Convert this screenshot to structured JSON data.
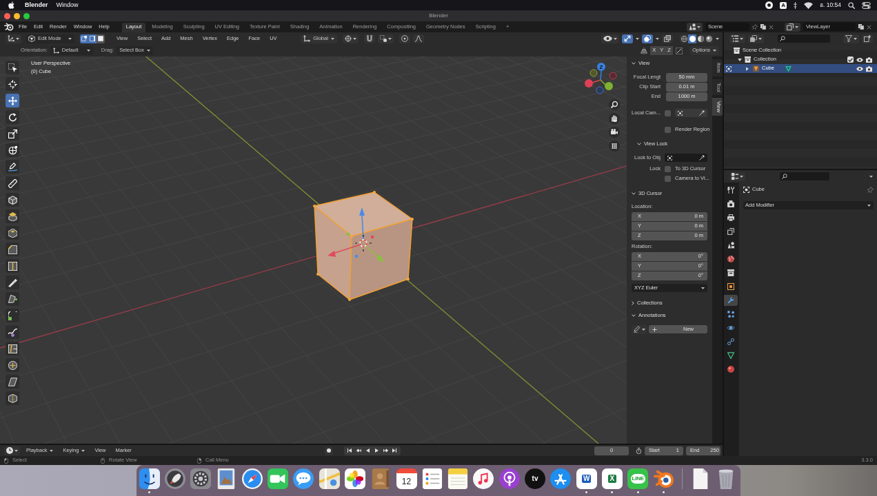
{
  "menubar": {
    "app": "Blender",
    "menus": [
      "Window"
    ],
    "input_source": "A",
    "clock": "อ. 10:54"
  },
  "window": {
    "title": "Blender"
  },
  "topbar": {
    "menus": [
      "File",
      "Edit",
      "Render",
      "Window",
      "Help"
    ],
    "workspaces": [
      {
        "label": "Layout",
        "selected": true
      },
      {
        "label": "Modeling",
        "selected": false
      },
      {
        "label": "Sculpting",
        "selected": false
      },
      {
        "label": "UV Editing",
        "selected": false
      },
      {
        "label": "Texture Paint",
        "selected": false
      },
      {
        "label": "Shading",
        "selected": false
      },
      {
        "label": "Animation",
        "selected": false
      },
      {
        "label": "Rendering",
        "selected": false
      },
      {
        "label": "Compositing",
        "selected": false
      },
      {
        "label": "Geometry Nodes",
        "selected": false
      },
      {
        "label": "Scripting",
        "selected": false
      }
    ],
    "add_workspace": "+",
    "scene": "Scene",
    "view_layer": "ViewLayer"
  },
  "viewport_header": {
    "mode": "Edit Mode",
    "select_modes": [
      {
        "kind": "vertex",
        "selected": true
      },
      {
        "kind": "edge",
        "selected": true
      },
      {
        "kind": "face",
        "selected": false
      }
    ],
    "menus": [
      "View",
      "Select",
      "Add",
      "Mesh",
      "Vertex",
      "Edge",
      "Face",
      "UV"
    ],
    "orientation": "Global",
    "toggles": [
      {
        "kind": "gizmos",
        "on": true
      },
      {
        "kind": "overlays",
        "on": true
      },
      {
        "kind": "xray",
        "on": false
      }
    ],
    "shading_modes": [
      {
        "kind": "wireframe",
        "selected": false
      },
      {
        "kind": "solid",
        "selected": true
      },
      {
        "kind": "material",
        "selected": false
      },
      {
        "kind": "rendered",
        "selected": false
      }
    ]
  },
  "tool_settings": {
    "orientation_label": "Orientation:",
    "orientation": "Default",
    "drag_label": "Drag:",
    "drag": "Select Box",
    "mirror_axes": [
      "X",
      "Y",
      "Z"
    ],
    "options": "Options"
  },
  "viewport": {
    "perspective": "User Perspective",
    "object": "(0) Cube",
    "gizmo_axis": "Z",
    "tools": [
      {
        "kind": "select_box",
        "selected": false
      },
      {
        "kind": "cursor",
        "selected": false
      },
      {
        "kind": "move",
        "selected": true
      },
      {
        "kind": "rotate",
        "selected": false
      },
      {
        "kind": "scale",
        "selected": false
      },
      {
        "kind": "transform",
        "selected": false
      },
      {
        "kind": "annotate",
        "selected": false
      },
      {
        "kind": "measure",
        "selected": false
      },
      {
        "kind": "add_cube",
        "selected": false
      },
      {
        "kind": "extrude",
        "selected": false
      },
      {
        "kind": "inset",
        "selected": false
      },
      {
        "kind": "bevel",
        "selected": false
      },
      {
        "kind": "loop_cut",
        "selected": false
      },
      {
        "kind": "knife",
        "selected": false
      },
      {
        "kind": "poly_build",
        "selected": false
      },
      {
        "kind": "spin",
        "selected": false
      },
      {
        "kind": "smooth",
        "selected": false
      },
      {
        "kind": "edge_slide",
        "selected": false
      },
      {
        "kind": "shrink_fatten",
        "selected": false
      },
      {
        "kind": "shear",
        "selected": false
      },
      {
        "kind": "rip",
        "selected": false
      }
    ]
  },
  "sidebar": {
    "tabs": [
      {
        "label": "Item",
        "selected": false
      },
      {
        "label": "Tool",
        "selected": false
      },
      {
        "label": "View",
        "selected": true
      }
    ],
    "view": {
      "title": "View",
      "expanded": true,
      "fields": [
        {
          "label": "Focal Lengt",
          "value": "50 mm"
        },
        {
          "label": "Clip Start",
          "value": "0.01 m"
        },
        {
          "label": "End",
          "value": "1000 m"
        }
      ],
      "local_camera": {
        "label": "Local Cam...",
        "checked": false
      },
      "render_region": {
        "label": "Render Region",
        "checked": false
      }
    },
    "view_lock": {
      "title": "View Lock",
      "expanded": true,
      "lock_to_object": "Lock to Obj",
      "lock_label": "Lock",
      "options": [
        {
          "label": "To 3D Cursor",
          "checked": false
        },
        {
          "label": "Camera to Vi...",
          "checked": false
        }
      ]
    },
    "cursor": {
      "title": "3D Cursor",
      "expanded": true,
      "location_label": "Location:",
      "location": [
        {
          "axis": "X",
          "value": "0 m"
        },
        {
          "axis": "Y",
          "value": "0 m"
        },
        {
          "axis": "Z",
          "value": "0 m"
        }
      ],
      "rotation_label": "Rotation:",
      "rotation": [
        {
          "axis": "X",
          "value": "0°"
        },
        {
          "axis": "Y",
          "value": "0°"
        },
        {
          "axis": "Z",
          "value": "0°"
        }
      ],
      "rotation_mode": "XYZ Euler"
    },
    "collections": {
      "title": "Collections",
      "expanded": false
    },
    "annotations": {
      "title": "Annotations",
      "expanded": true,
      "new_button": "New"
    }
  },
  "outliner": {
    "tree": [
      {
        "kind": "scene_collection",
        "label": "Scene Collection",
        "selected": false,
        "children": [
          {
            "kind": "collection",
            "label": "Collection",
            "selected": false,
            "expanded": true,
            "checked": true,
            "children": [
              {
                "kind": "mesh_object",
                "label": "Cube",
                "selected": true,
                "expanded": false
              }
            ]
          }
        ]
      }
    ]
  },
  "properties": {
    "tabs": [
      {
        "kind": "tool",
        "selected": false
      },
      {
        "kind": "render",
        "selected": false
      },
      {
        "kind": "output",
        "selected": false
      },
      {
        "kind": "view_layer",
        "selected": false
      },
      {
        "kind": "scene",
        "selected": false
      },
      {
        "kind": "world",
        "selected": false
      },
      {
        "kind": "collection",
        "selected": false
      },
      {
        "kind": "object",
        "selected": false
      },
      {
        "kind": "modifiers",
        "selected": true
      },
      {
        "kind": "particles",
        "selected": false
      },
      {
        "kind": "physics",
        "selected": false
      },
      {
        "kind": "constraints",
        "selected": false
      },
      {
        "kind": "data",
        "selected": false
      },
      {
        "kind": "material",
        "selected": false
      }
    ],
    "object": "Cube",
    "add_modifier": "Add Modifier"
  },
  "timeline": {
    "menus": [
      {
        "label": "Playback",
        "dropdown": true
      },
      {
        "label": "Keying",
        "dropdown": true
      },
      {
        "label": "View",
        "dropdown": false
      },
      {
        "label": "Marker",
        "dropdown": false
      }
    ],
    "current_frame": "0",
    "start_label": "Start",
    "start": "1",
    "end_label": "End",
    "end": "250"
  },
  "status_bar": {
    "hints": [
      {
        "kind": "left_click",
        "label": "Select"
      },
      {
        "kind": "middle_click",
        "label": "Rotate View"
      },
      {
        "kind": "right_click",
        "label": "Call Menu"
      }
    ],
    "version": "3.3.0"
  },
  "dock": {
    "apps": [
      {
        "kind": "finder",
        "running": true
      },
      {
        "kind": "launchpad",
        "running": false
      },
      {
        "kind": "settings",
        "running": false
      },
      {
        "kind": "preview",
        "running": false
      },
      {
        "kind": "safari",
        "running": false
      },
      {
        "kind": "facetime",
        "running": false
      },
      {
        "kind": "messages",
        "running": false
      },
      {
        "kind": "maps",
        "running": false
      },
      {
        "kind": "photos",
        "running": false
      },
      {
        "kind": "contacts",
        "running": false
      },
      {
        "kind": "calendar",
        "label": "12",
        "running": false
      },
      {
        "kind": "reminders",
        "running": false
      },
      {
        "kind": "notes",
        "running": false
      },
      {
        "kind": "music",
        "running": false
      },
      {
        "kind": "podcasts",
        "running": false
      },
      {
        "kind": "tv",
        "label": "tv",
        "running": false
      },
      {
        "kind": "app_store",
        "running": false
      },
      {
        "kind": "word",
        "label": "W",
        "running": true
      },
      {
        "kind": "excel",
        "label": "X",
        "running": true
      },
      {
        "kind": "line",
        "label": "LINE",
        "running": true
      },
      {
        "kind": "blender",
        "running": true
      }
    ],
    "stack": [
      {
        "kind": "document"
      },
      {
        "kind": "trash"
      }
    ]
  }
}
